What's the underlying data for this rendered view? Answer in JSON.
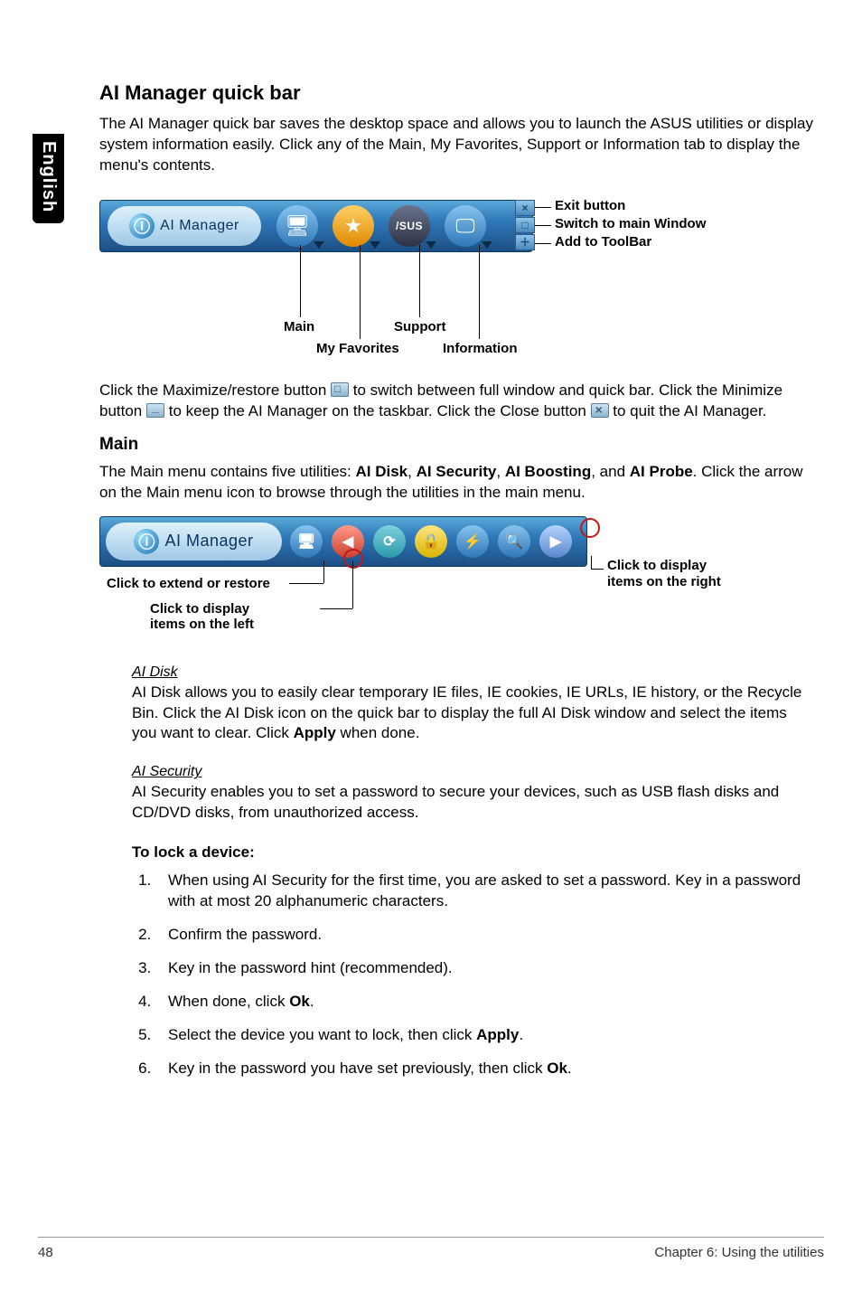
{
  "sideTab": "English",
  "heading_quickbar": "AI Manager quick bar",
  "intro_quickbar": "The AI Manager quick bar saves the desktop space and allows you to launch the ASUS utilities or display system information easily. Click any of the Main, My Favorites, Support or Information tab to display the menu's contents.",
  "bar": {
    "logoText": "AI Manager",
    "annot_exit": "Exit button",
    "annot_switch": "Switch to main Window",
    "annot_add": "Add to ToolBar",
    "label_main": "Main",
    "label_support": "Support",
    "label_fav": "My Favorites",
    "label_info": "Information"
  },
  "para_click_pre": "Click the Maximize/restore button ",
  "para_click_mid1": " to switch between full window and quick bar. Click the Minimize button ",
  "para_click_mid2": " to keep the AI Manager on the taskbar. Click the Close button ",
  "para_click_post": " to quit the AI Manager.",
  "heading_main": "Main",
  "para_main_pre": "The Main menu contains five utilities: ",
  "util1": "AI Disk",
  "util2": "AI Security",
  "util3": "AI Boosting",
  "util4": "AI Probe",
  "para_main_post": ". Click the arrow on the Main menu icon to browse through the utilities in the main menu.",
  "d2": {
    "right1": "Click to display",
    "right2": "items on the right",
    "extend": "Click to extend or restore",
    "left1": "Click to display",
    "left2": "items on the left"
  },
  "aidisk_head": "AI Disk",
  "aidisk_body_pre": "AI Disk allows you to easily clear temporary IE files, IE cookies, IE URLs, IE history, or the Recycle Bin. Click the AI Disk icon on the quick bar to display the full AI Disk window and select the items you want to clear. Click ",
  "aidisk_apply": "Apply",
  "aidisk_body_post": " when done.",
  "aisec_head": "AI Security",
  "aisec_body": "AI Security enables you to set a password to secure your devices, such as USB flash disks and CD/DVD disks, from unauthorized access.",
  "lock_head": "To lock a device:",
  "steps": {
    "s1": "When using AI Security for the first time, you are asked to set a password. Key in a password with at most 20 alphanumeric characters.",
    "s2": "Confirm the password.",
    "s3": "Key in the password hint (recommended).",
    "s4_pre": "When done, click ",
    "s4_ok": "Ok",
    "s4_post": ".",
    "s5_pre": "Select the device you want to lock, then click ",
    "s5_apply": "Apply",
    "s5_post": ".",
    "s6_pre": "Key in the password you have set previously, then click ",
    "s6_ok": "Ok",
    "s6_post": "."
  },
  "footer_page": "48",
  "footer_chapter": "Chapter 6: Using the utilities"
}
